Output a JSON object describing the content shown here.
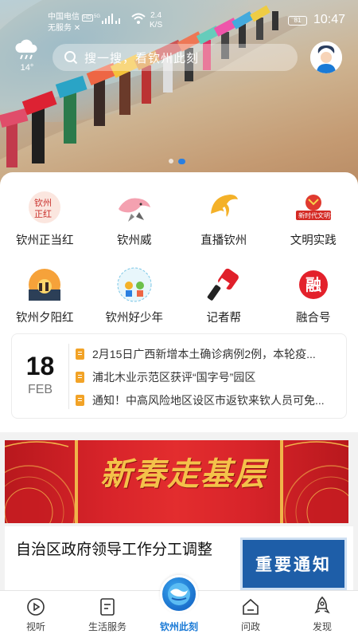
{
  "status": {
    "carrier": "中国电信",
    "carrier_badge": "HD",
    "no_service": "无服务",
    "network": "5G",
    "speed_value": "2.4",
    "speed_unit": "K/S",
    "battery": "81",
    "time": "10:47"
  },
  "header": {
    "weather_icon": "cloud-rain-icon",
    "temperature": "14°",
    "search_placeholder": "搜一搜，看钦州此刻",
    "avatar_icon": "user-avatar-icon"
  },
  "carousel": {
    "count": 2,
    "active": 2
  },
  "services": [
    {
      "label": "钦州正当红",
      "icon": "zhengdanghong-icon"
    },
    {
      "label": "钦州威",
      "icon": "dolphin-icon"
    },
    {
      "label": "直播钦州",
      "icon": "live-dolphin-icon"
    },
    {
      "label": "文明实践",
      "icon": "civilization-badge-icon"
    },
    {
      "label": "钦州夕阳红",
      "icon": "sunset-icon"
    },
    {
      "label": "钦州好少年",
      "icon": "youth-icon"
    },
    {
      "label": "记者帮",
      "icon": "microphone-icon"
    },
    {
      "label": "融合号",
      "icon": "ronghe-icon"
    }
  ],
  "news": {
    "day": "18",
    "month": "FEB",
    "headlines": [
      "2月15日广西新增本土确诊病例2例，本轮疫...",
      "浦北木业示范区获评“国字号”园区",
      "通知！中高风险地区设区市返钦来钦人员可免..."
    ]
  },
  "banner": {
    "title": "新春走基层"
  },
  "article": {
    "title": "自治区政府领导工作分工调整",
    "thumb_text": "重要通知"
  },
  "tabs": [
    {
      "label": "视听",
      "icon": "play-circle-icon"
    },
    {
      "label": "生活服务",
      "icon": "document-icon"
    },
    {
      "label": "钦州此刻",
      "icon": "qinzhou-globe-icon",
      "active": true
    },
    {
      "label": "问政",
      "icon": "home-icon"
    },
    {
      "label": "发现",
      "icon": "rocket-icon"
    }
  ],
  "colors": {
    "accent": "#1a7ad6",
    "banner_red": "#d8242a",
    "banner_gold": "#f4c24a",
    "doc_icon": "#f2a327"
  }
}
